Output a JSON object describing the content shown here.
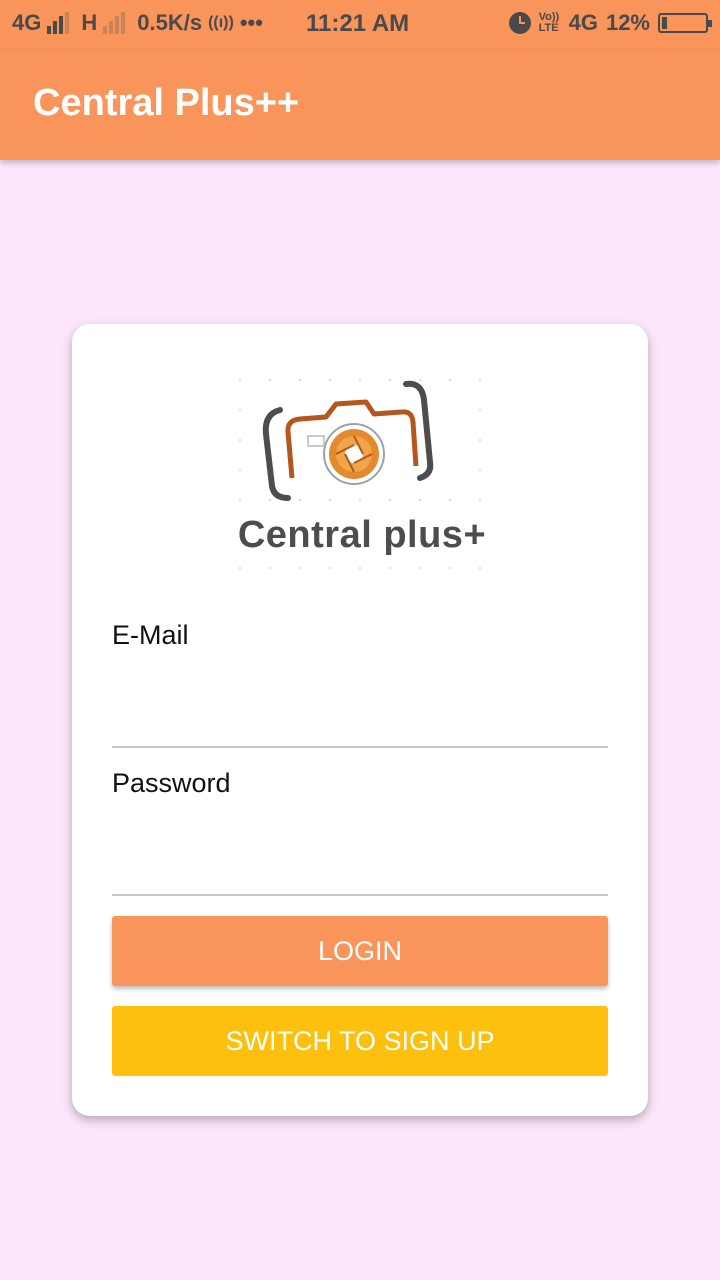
{
  "status_bar": {
    "network_left": "4G",
    "network_mid": "H",
    "speed": "0.5K/s",
    "time": "11:21 AM",
    "volte": "Vo)) LTE",
    "network_right": "4G",
    "battery": "12%"
  },
  "app_bar": {
    "title": "Central Plus++"
  },
  "logo": {
    "text": "Central plus+"
  },
  "form": {
    "email_label": "E-Mail",
    "email_value": "",
    "password_label": "Password",
    "password_value": ""
  },
  "buttons": {
    "login": "LOGIN",
    "signup": "SWITCH TO SIGN UP"
  },
  "colors": {
    "accent": "#f9955b",
    "secondary": "#fec00f",
    "background": "#fbe6fb"
  }
}
